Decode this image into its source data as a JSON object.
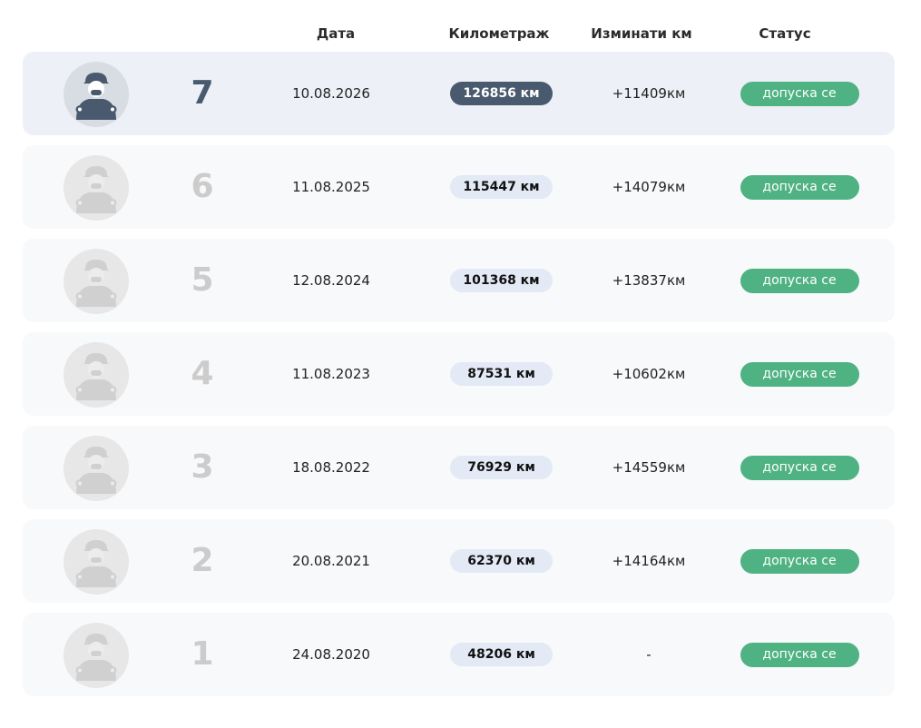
{
  "header": {
    "date": "Дата",
    "mileage": "Километраж",
    "traveled": "Изминати км",
    "status": "Статус"
  },
  "colors": {
    "status_green": "#4fb283",
    "current_dark": "#4a5a6e",
    "pill_light": "#e3eaf5",
    "row_bg": "#f8f9fa",
    "current_row_bg": "#edf1f7"
  },
  "avatar_icon": "mechanic-icon",
  "rows": [
    {
      "number": "7",
      "date": "10.08.2026",
      "mileage": "126856 км",
      "traveled": "+11409км",
      "status": "допуска се",
      "current": true
    },
    {
      "number": "6",
      "date": "11.08.2025",
      "mileage": "115447 км",
      "traveled": "+14079км",
      "status": "допуска се",
      "current": false
    },
    {
      "number": "5",
      "date": "12.08.2024",
      "mileage": "101368 км",
      "traveled": "+13837км",
      "status": "допуска се",
      "current": false
    },
    {
      "number": "4",
      "date": "11.08.2023",
      "mileage": "87531 км",
      "traveled": "+10602км",
      "status": "допуска се",
      "current": false
    },
    {
      "number": "3",
      "date": "18.08.2022",
      "mileage": "76929 км",
      "traveled": "+14559км",
      "status": "допуска се",
      "current": false
    },
    {
      "number": "2",
      "date": "20.08.2021",
      "mileage": "62370 км",
      "traveled": "+14164км",
      "status": "допуска се",
      "current": false
    },
    {
      "number": "1",
      "date": "24.08.2020",
      "mileage": "48206 км",
      "traveled": "-",
      "status": "допуска се",
      "current": false
    }
  ]
}
